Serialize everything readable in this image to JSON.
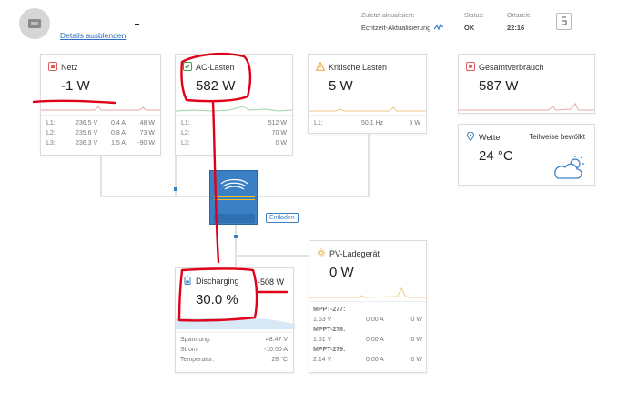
{
  "header": {
    "details_link": "Details ausblenden",
    "updated_label": "Zuletzt aktualisiert:",
    "updated_value": "Echtzeit-Aktualisierung",
    "status_label": "Status:",
    "status_value": "OK",
    "time_label": "Ortszeit:",
    "time_value": "22:16"
  },
  "netz": {
    "title": "Netz",
    "value": "-1 W",
    "rows": [
      {
        "phase": "L1:",
        "voltage": "236.5 V",
        "current": "0.4 A",
        "power": "48 W"
      },
      {
        "phase": "L2:",
        "voltage": "235.6 V",
        "current": "0.8 A",
        "power": "73 W"
      },
      {
        "phase": "L3:",
        "voltage": "236.3 V",
        "current": "1.5 A",
        "power": "-90 W"
      }
    ]
  },
  "ac_lasten": {
    "title": "AC-Lasten",
    "value": "582 W",
    "rows": [
      {
        "phase": "L1:",
        "power": "512 W"
      },
      {
        "phase": "L2:",
        "power": "70 W"
      },
      {
        "phase": "L3:",
        "power": "0 W"
      }
    ]
  },
  "kritische_lasten": {
    "title": "Kritische Lasten",
    "value": "5 W",
    "rows": [
      {
        "phase": "L1:",
        "freq": "50.1 Hz",
        "power": "5 W"
      }
    ]
  },
  "gesamtverbrauch": {
    "title": "Gesamtverbrauch",
    "value": "587 W"
  },
  "wetter": {
    "title": "Wetter",
    "condition": "Teilweise bewölkt",
    "value": "24 °C"
  },
  "inverter": {
    "mode_label": "Entladen"
  },
  "pv": {
    "title": "PV-Ladegerät",
    "value": "0 W",
    "mppts": [
      {
        "name": "MPPT-277:",
        "voltage": "1.63 V",
        "current": "0.00 A",
        "power": "0 W"
      },
      {
        "name": "MPPT-278:",
        "voltage": "1.51 V",
        "current": "0.00 A",
        "power": "0 W"
      },
      {
        "name": "MPPT-279:",
        "voltage": "2.14 V",
        "current": "0.00 A",
        "power": "0 W"
      }
    ]
  },
  "battery": {
    "title": "Discharging",
    "power": "-508 W",
    "soc": "30.0 %",
    "rows": [
      {
        "label": "Spannung:",
        "value": "48.47 V"
      },
      {
        "label": "Strom:",
        "value": "-10.50 A"
      },
      {
        "label": "Temperatur:",
        "value": "28 °C"
      }
    ]
  },
  "colors": {
    "accent_blue": "#3b7fc4",
    "red_annotation": "#e0001a",
    "ok_green": "#2d9a3e"
  }
}
